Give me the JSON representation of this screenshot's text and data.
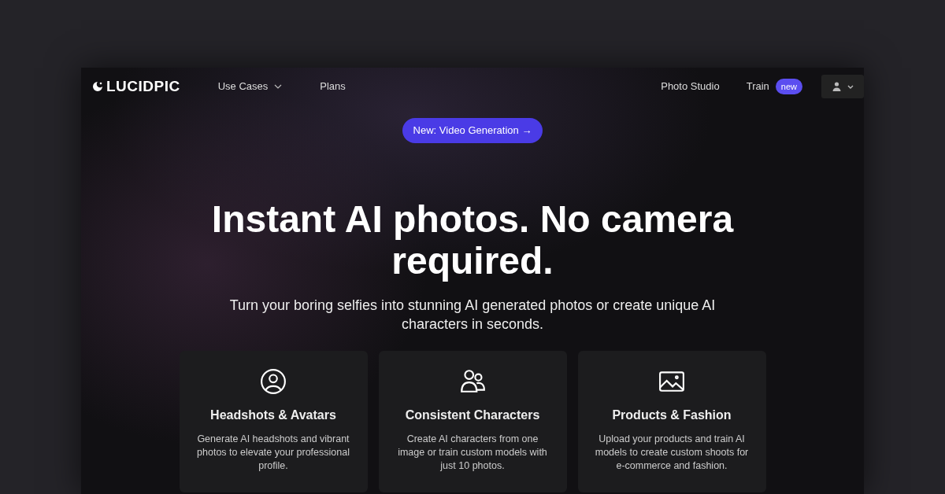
{
  "navbar": {
    "logo": "LUCIDPIC",
    "links": [
      {
        "label": "Use Cases",
        "dropdown": true
      },
      {
        "label": "Plans",
        "dropdown": false
      }
    ],
    "right_links": [
      {
        "label": "Photo Studio"
      },
      {
        "label": "Train",
        "badge": "new"
      }
    ]
  },
  "announcement": "New: Video Generation →",
  "hero": {
    "title": "Instant AI photos. No camera required.",
    "subtitle": "Turn your boring selfies into stunning AI generated photos or create unique AI characters in seconds."
  },
  "features": [
    {
      "kind": "person",
      "title": "Headshots & Avatars",
      "text": "Generate AI headshots and vibrant photos to elevate your professional profile."
    },
    {
      "kind": "group",
      "title": "Consistent Characters",
      "text": "Create AI characters from one image or train custom models with just 10 photos."
    },
    {
      "kind": "image",
      "title": "Products & Fashion",
      "text": "Upload your products and train AI models to create custom shoots for e-commerce and fashion."
    }
  ]
}
